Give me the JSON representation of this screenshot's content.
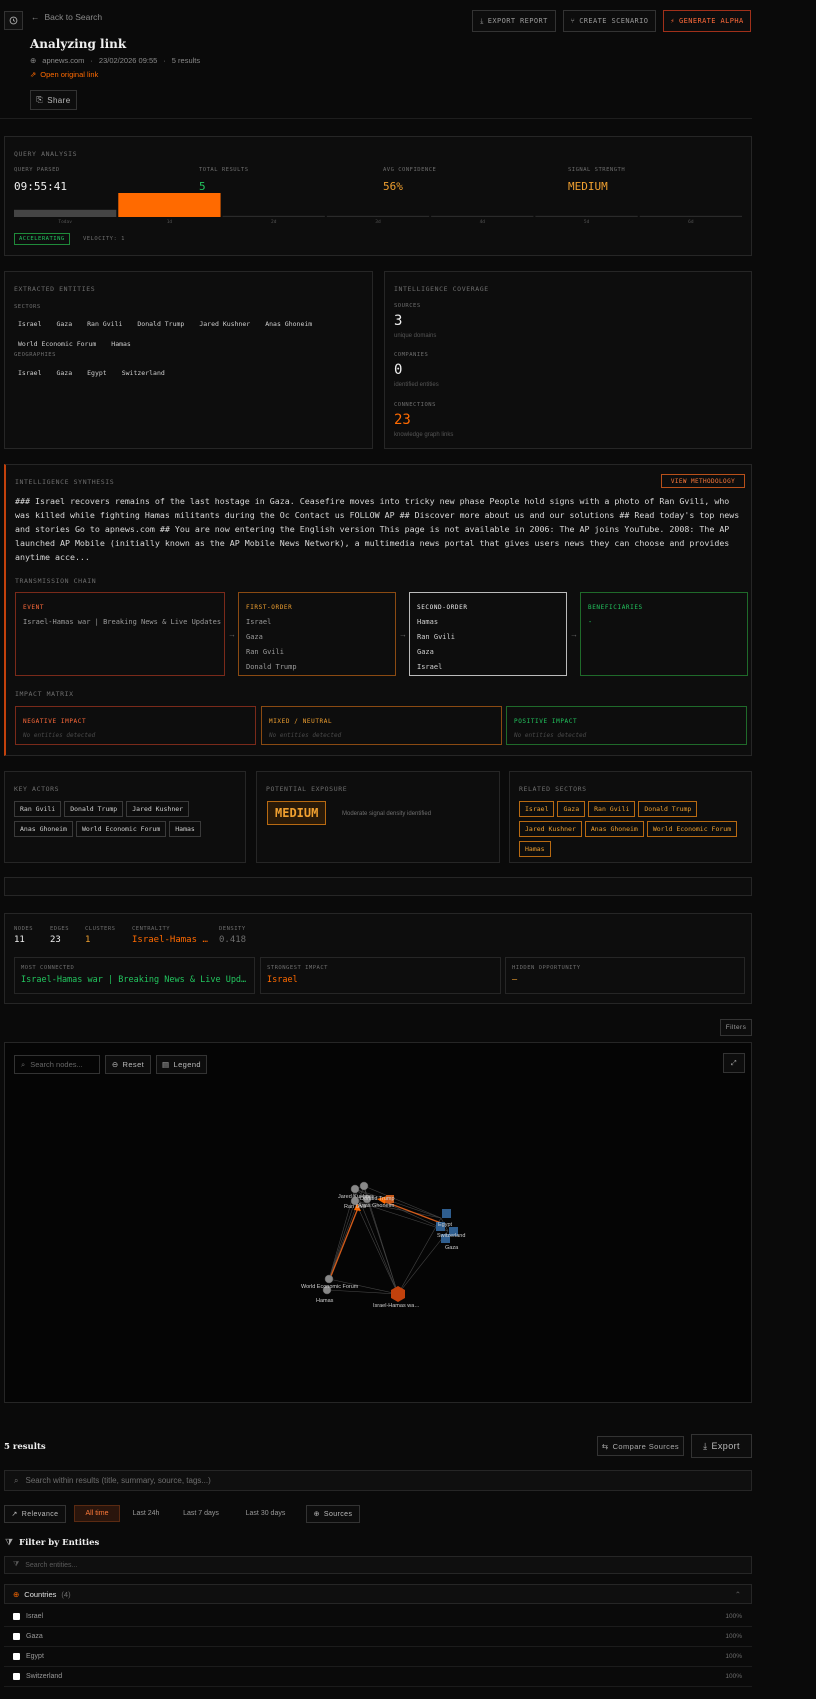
{
  "header": {
    "back_label": "Back to Search",
    "title": "Analyzing link",
    "source": "apnews.com",
    "datetime": "23/02/2026 09:55",
    "results": "5 results",
    "open_link": "Open original link",
    "share_label": "Share",
    "export_report": "EXPORT REPORT",
    "create_scenario": "CREATE SCENARIO",
    "generate_alpha": "GENERATE ALPHA"
  },
  "query_analysis": {
    "title": "QUERY ANALYSIS",
    "query_parsed_label": "QUERY PARSED",
    "query_parsed": "09:55:41",
    "total_results_label": "TOTAL RESULTS",
    "total_results": "5",
    "avg_conf_label": "AVG CONFIDENCE",
    "avg_conf": "56%",
    "signal_label": "SIGNAL STRENGTH",
    "signal": "MEDIUM",
    "bar_labels": [
      "Today",
      "1d",
      "2d",
      "3d",
      "4d",
      "5d",
      "6d"
    ],
    "bar_levels": [
      0.3,
      1.0,
      0.05,
      0.05,
      0.05,
      0.05,
      0.05
    ],
    "accelerating": "ACCELERATING",
    "velocity": "VELOCITY: 1"
  },
  "entities": {
    "title": "EXTRACTED ENTITIES",
    "sectors_label": "SECTORS",
    "sectors": [
      "Israel",
      "Gaza",
      "Ran Gvili",
      "Donald Trump",
      "Jared Kushner",
      "Anas Ghoneim",
      "World Economic Forum",
      "Hamas"
    ],
    "geographies_label": "GEOGRAPHIES",
    "geographies": [
      "Israel",
      "Gaza",
      "Egypt",
      "Switzerland"
    ]
  },
  "coverage": {
    "title": "INTELLIGENCE COVERAGE",
    "sources_label": "SOURCES",
    "sources": "3",
    "sources_sub": "unique domains",
    "companies_label": "COMPANIES",
    "companies": "0",
    "companies_sub": "identified entities",
    "connections_label": "CONNECTIONS",
    "connections": "23",
    "connections_sub": "knowledge graph links"
  },
  "synthesis": {
    "title": "INTELLIGENCE SYNTHESIS",
    "view_methodology": "VIEW METHODOLOGY",
    "text": "### Israel recovers remains of the last hostage in Gaza. Ceasefire moves into tricky new phase People hold signs with a photo of Ran Gvili, who was killed while fighting Hamas militants during the Oc Contact us FOLLOW AP ## Discover more about us and our solutions ## Read today's top news and stories Go to apnews.com ## You are now entering the English version This page is not available in 2006: The AP joins YouTube. 2008: The AP launched AP Mobile (initially known as the AP Mobile News Network), a multimedia news portal that gives users news they can choose and provides anytime acce...",
    "chain_label": "TRANSMISSION CHAIN",
    "event_label": "EVENT",
    "event_items": [
      "Israel-Hamas war | Breaking News & Live Updates"
    ],
    "first_label": "FIRST-ORDER",
    "first_items": [
      "Israel",
      "Gaza",
      "Ran Gvili",
      "Donald Trump"
    ],
    "second_label": "SECOND-ORDER",
    "second_items": [
      "Hamas",
      "Ran Gvili",
      "Gaza",
      "Israel"
    ],
    "beneficiaries_label": "BENEFICIARIES",
    "beneficiaries_items": [
      "-"
    ],
    "impact_label": "IMPACT MATRIX",
    "negative_label": "NEGATIVE IMPACT",
    "mixed_label": "MIXED / NEUTRAL",
    "positive_label": "POSITIVE IMPACT",
    "none_text": "No entities detected"
  },
  "actors": {
    "title": "KEY ACTORS",
    "items": [
      "Ran Gvili",
      "Donald Trump",
      "Jared Kushner",
      "Anas Ghoneim",
      "World Economic Forum",
      "Hamas"
    ]
  },
  "exposure": {
    "title": "POTENTIAL EXPOSURE",
    "level": "MEDIUM",
    "desc": "Moderate signal density identified"
  },
  "related": {
    "title": "RELATED SECTORS",
    "items": [
      "Israel",
      "Gaza",
      "Ran Gvili",
      "Donald Trump",
      "Jared Kushner",
      "Anas Ghoneim",
      "World Economic Forum",
      "Hamas"
    ]
  },
  "graph_stats": {
    "nodes_label": "NODES",
    "nodes": "11",
    "edges_label": "EDGES",
    "edges": "23",
    "clusters_label": "CLUSTERS",
    "clusters": "1",
    "centrality_label": "CENTRALITY",
    "centrality": "Israel-Hamas …",
    "density_label": "DENSITY",
    "density": "0.418",
    "most_connected_label": "MOST CONNECTED",
    "most_connected": "Israel-Hamas war | Breaking News & Live Upd…",
    "strongest_label": "STRONGEST IMPACT",
    "strongest": "Israel",
    "hidden_label": "HIDDEN OPPORTUNITY",
    "hidden": "–",
    "filters": "Filters"
  },
  "graph": {
    "search_placeholder": "Search nodes...",
    "reset": "Reset",
    "legend": "Legend",
    "node_labels": [
      "Jared Kushner",
      "Donald Trump",
      "Ran Gvili",
      "Anas Ghoneim",
      "Egypt",
      "Switzerland",
      "Gaza",
      "World Economic Forum",
      "Hamas",
      "Israel-Hamas wa…"
    ]
  },
  "results": {
    "count": "5 results",
    "compare": "Compare Sources",
    "export": "Export",
    "search_placeholder": "Search within results (title, summary, source, tags...)",
    "relevance": "Relevance",
    "time_filters": [
      "All time",
      "Last 24h",
      "Last 7 days",
      "Last 30 days"
    ],
    "sources": "Sources",
    "filter_entities": "Filter by Entities",
    "entity_search_placeholder": "Search entities...",
    "countries_label": "Countries",
    "countries_count": "(4)",
    "countries": [
      {
        "name": "Israel",
        "pct": "100%"
      },
      {
        "name": "Gaza",
        "pct": "100%"
      },
      {
        "name": "Egypt",
        "pct": "100%"
      },
      {
        "name": "Switzerland",
        "pct": "100%"
      }
    ]
  },
  "colors": {
    "accent": "#ff6a00",
    "green": "#22c55e",
    "amber": "#f0a030"
  }
}
